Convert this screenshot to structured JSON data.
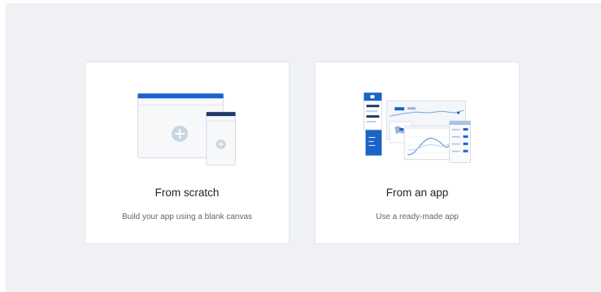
{
  "colors": {
    "accent": "#1a63c8",
    "background": "#eff1f4",
    "card": "#ffffff"
  },
  "options": [
    {
      "key": "scratch",
      "title": "From scratch",
      "description": "Build your app using a blank canvas",
      "icon": "blank-canvas-illustration"
    },
    {
      "key": "app",
      "title": "From an app",
      "description": "Use a ready-made app",
      "icon": "ready-made-app-illustration"
    }
  ]
}
